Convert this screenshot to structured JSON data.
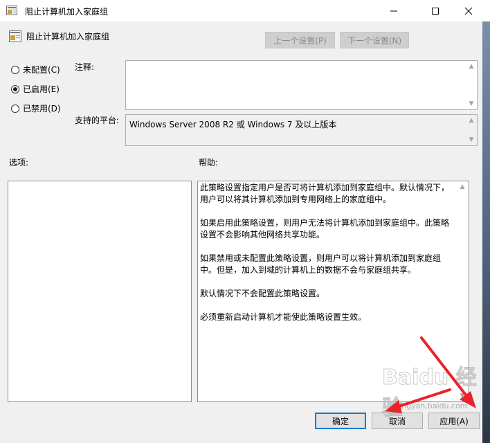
{
  "window": {
    "title": "阻止计算机加入家庭组",
    "header_title": "阻止计算机加入家庭组",
    "prev_setting": "上一个设置(P)",
    "next_setting": "下一个设置(N)"
  },
  "state": {
    "options": [
      {
        "label": "未配置(C)",
        "checked": false
      },
      {
        "label": "已启用(E)",
        "checked": true
      },
      {
        "label": "已禁用(D)",
        "checked": false
      }
    ]
  },
  "comment": {
    "label": "注释:",
    "value": ""
  },
  "platform": {
    "label": "支持的平台:",
    "value": "Windows Server 2008 R2 或 Windows 7 及以上版本"
  },
  "panes": {
    "options_label": "选项:",
    "help_label": "帮助:",
    "help_paragraphs": [
      "此策略设置指定用户是否可将计算机添加到家庭组中。默认情况下，用户可以将其计算机添加到专用网络上的家庭组中。",
      "如果启用此策略设置，则用户无法将计算机添加到家庭组中。此策略设置不会影响其他网络共享功能。",
      "如果禁用或未配置此策略设置，则用户可以将计算机添加到家庭组中。但是，加入到域的计算机上的数据不会与家庭组共享。",
      "默认情况下不会配置此策略设置。",
      "必须重新启动计算机才能使此策略设置生效。"
    ]
  },
  "buttons": {
    "ok": "确定",
    "cancel": "取消",
    "apply": "应用(A)"
  },
  "watermark": {
    "logo": "Baidu 经验",
    "url": "jingyan.baidu.com"
  },
  "colors": {
    "focus_border": "#0078d7",
    "annotation": "#e8232a"
  }
}
